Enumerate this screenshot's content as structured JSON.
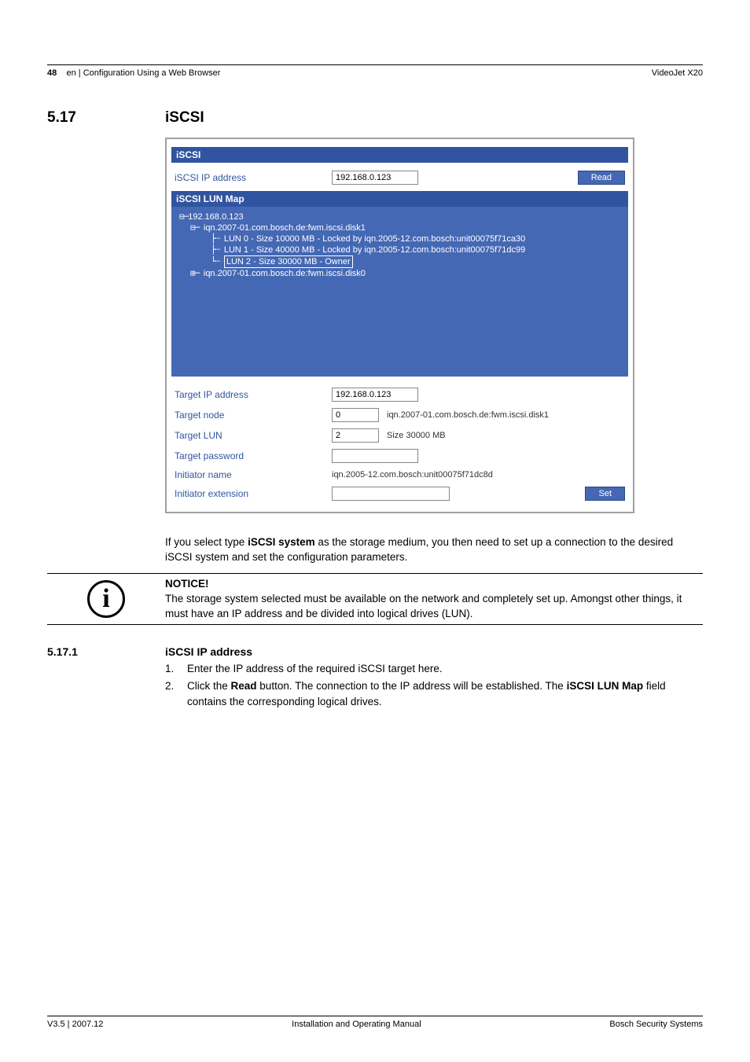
{
  "header": {
    "page_num": "48",
    "breadcrumb": "en | Configuration Using a Web Browser",
    "product": "VideoJet X20"
  },
  "section": {
    "number": "5.17",
    "title": "iSCSI"
  },
  "screenshot": {
    "panel_title": "iSCSI",
    "ip_label": "iSCSI IP address",
    "ip_value": "192.168.0.123",
    "read_btn": "Read",
    "lunmap_title": "iSCSI LUN Map",
    "tree": {
      "root": "192.168.0.123",
      "disk1": "iqn.2007-01.com.bosch.de:fwm.iscsi.disk1",
      "lun0": "LUN 0 - Size 10000 MB - Locked by iqn.2005-12.com.bosch:unit00075f71ca30",
      "lun1": "LUN 1 - Size 40000 MB - Locked by iqn.2005-12.com.bosch:unit00075f71dc99",
      "lun2": "LUN 2 - Size 30000 MB - Owner",
      "disk0": "iqn.2007-01.com.bosch.de:fwm.iscsi.disk0"
    },
    "target_ip_label": "Target IP address",
    "target_ip_value": "192.168.0.123",
    "target_node_label": "Target node",
    "target_node_value": "0",
    "target_node_after": "iqn.2007-01.com.bosch.de:fwm.iscsi.disk1",
    "target_lun_label": "Target LUN",
    "target_lun_value": "2",
    "target_lun_after": "Size 30000 MB",
    "target_pw_label": "Target password",
    "target_pw_value": "",
    "initiator_name_label": "Initiator name",
    "initiator_name_value": "iqn.2005-12.com.bosch:unit00075f71dc8d",
    "initiator_ext_label": "Initiator extension",
    "initiator_ext_value": "",
    "set_btn": "Set"
  },
  "body": {
    "para_pre": "If you select type ",
    "para_bold1": "iSCSI system",
    "para_post": " as the storage medium, you then need to set up a connection to the desired iSCSI system and set the configuration parameters."
  },
  "notice": {
    "heading": "NOTICE!",
    "text": "The storage system selected must be available on the network and completely set up. Amongst other things, it must have an IP address and be divided into logical drives (LUN)."
  },
  "subsection": {
    "number": "5.17.1",
    "title": "iSCSI IP address",
    "items": {
      "n1": "1.",
      "t1": "Enter the IP address of the required iSCSI target here.",
      "n2": "2.",
      "t2_pre": "Click the ",
      "t2_b1": "Read",
      "t2_mid": " button. The connection to the IP address will be established. The ",
      "t2_b2": "iSCSI LUN Map",
      "t2_post": " field contains the corresponding logical drives."
    }
  },
  "footer": {
    "left": "V3.5 | 2007.12",
    "center": "Installation and Operating Manual",
    "right": "Bosch Security Systems"
  }
}
